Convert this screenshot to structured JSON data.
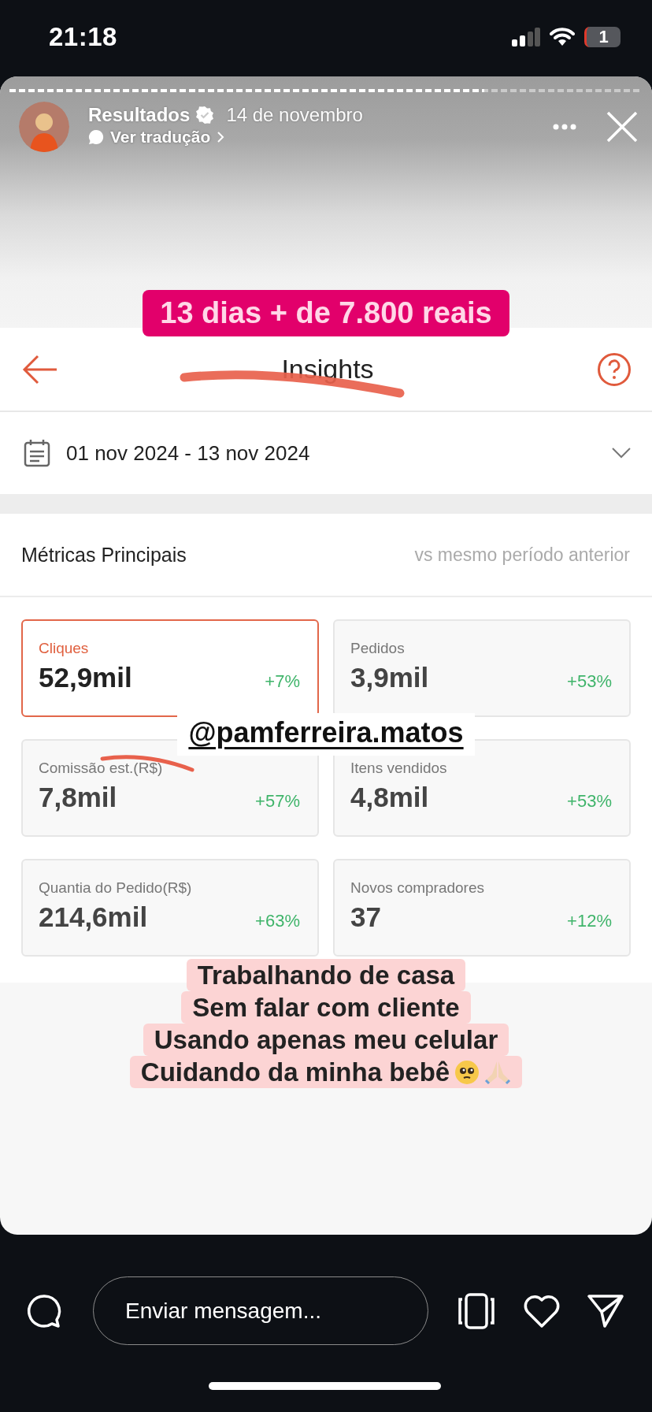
{
  "status_bar": {
    "time": "21:18",
    "battery": "1"
  },
  "story": {
    "progress": {
      "level": 0.75
    },
    "author": "Resultados",
    "verified": true,
    "date": "14 de novembro",
    "translate_link": "Ver tradução"
  },
  "screenshot": {
    "title": "Insights",
    "date_range": "01 nov 2024 - 13 nov 2024",
    "section_title": "Métricas Principais",
    "comparison_note": "vs mesmo período anterior",
    "metrics": [
      {
        "label": "Cliques",
        "value": "52,9mil",
        "change": "+7%",
        "selected": true
      },
      {
        "label": "Pedidos",
        "value": "3,9mil",
        "change": "+53%",
        "selected": false
      },
      {
        "label": "Comissão est.(R$)",
        "value": "7,8mil",
        "change": "+57%",
        "selected": false
      },
      {
        "label": "Itens vendidos",
        "value": "4,8mil",
        "change": "+53%",
        "selected": false
      },
      {
        "label": "Quantia do Pedido(R$)",
        "value": "214,6mil",
        "change": "+63%",
        "selected": false
      },
      {
        "label": "Novos compradores",
        "value": "37",
        "change": "+12%",
        "selected": false
      }
    ]
  },
  "stickers": [
    {
      "kind": "banner",
      "text": "13 dias + de 7.800 reais"
    },
    {
      "kind": "mention",
      "text": "@pamferreira.matos"
    },
    {
      "kind": "caption",
      "lines": [
        "Trabalhando de casa",
        "Sem falar com cliente",
        "Usando apenas meu celular",
        "Cuidando da minha bebê"
      ]
    }
  ],
  "reply_bar": {
    "placeholder": "Enviar mensagem..."
  }
}
